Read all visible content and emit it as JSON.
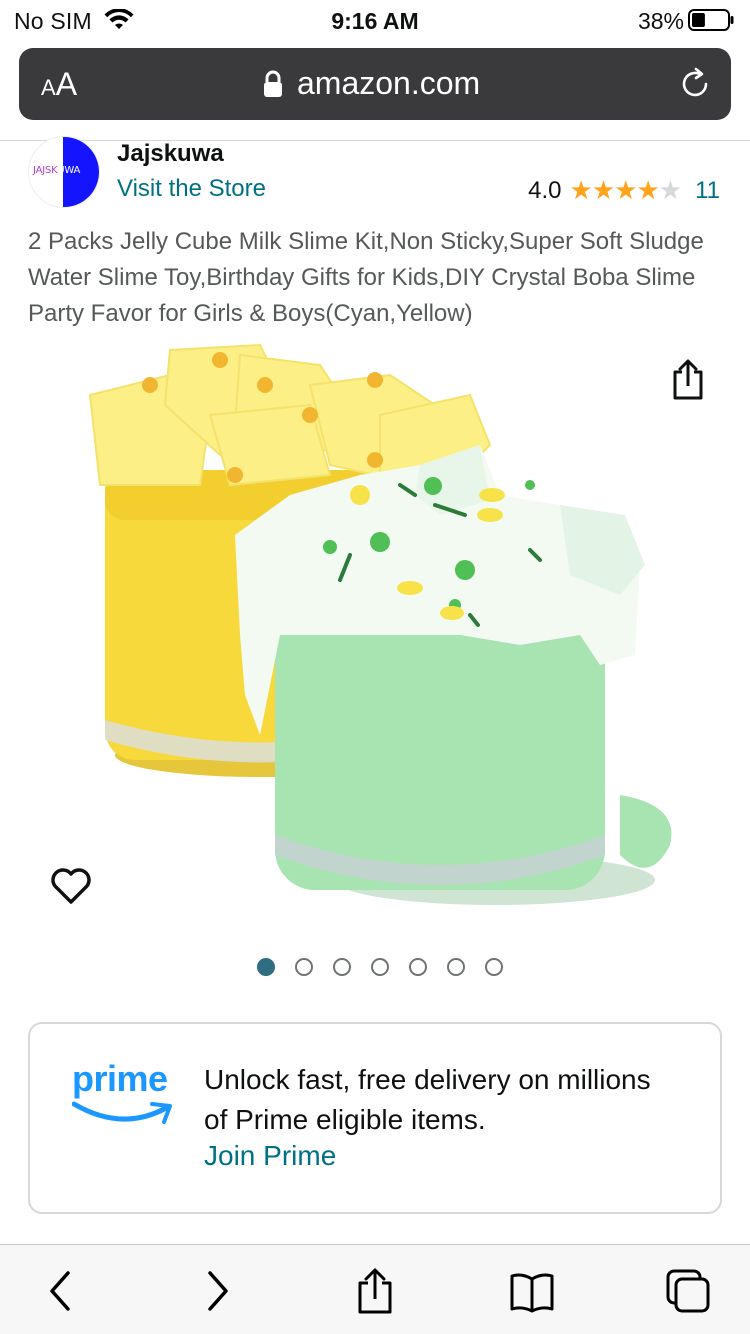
{
  "status_bar": {
    "carrier": "No SIM",
    "time": "9:16 AM",
    "battery_percent": "38%",
    "battery_level": 0.38
  },
  "browser": {
    "text_size_label_small": "A",
    "text_size_label_large": "A",
    "url": "amazon.com"
  },
  "brand": {
    "logo_text_left": "JAJSK",
    "logo_text_right": "UWA",
    "name": "Jajskuwa",
    "visit_store": "Visit the Store"
  },
  "rating": {
    "value": "4.0",
    "stars": 4,
    "max_stars": 5,
    "count": "11"
  },
  "product": {
    "title": "2 Packs Jelly Cube Milk Slime Kit,Non Sticky,Super Soft Sludge Water Slime Toy,Birthday Gifts for Kids,DIY Crystal Boba Slime Party Favor for Girls & Boys(Cyan,Yellow)"
  },
  "carousel": {
    "total": 7,
    "active_index": 0
  },
  "prime": {
    "logo_word": "prime",
    "message": "Unlock fast, free delivery on millions of Prime eligible items.",
    "link": "Join Prime"
  },
  "colors": {
    "link": "#007185",
    "star": "#ffa41c",
    "prime_blue": "#1a98ff",
    "url_bar": "#3a3a3c"
  },
  "icons": {
    "wifi": "wifi-icon",
    "battery": "battery-icon",
    "lock": "lock-icon",
    "reload": "reload-icon",
    "share": "share-icon",
    "heart": "heart-icon",
    "back": "chevron-left-icon",
    "forward": "chevron-right-icon",
    "toolbar_share": "share-icon",
    "bookmarks": "book-icon",
    "tabs": "tabs-icon"
  }
}
